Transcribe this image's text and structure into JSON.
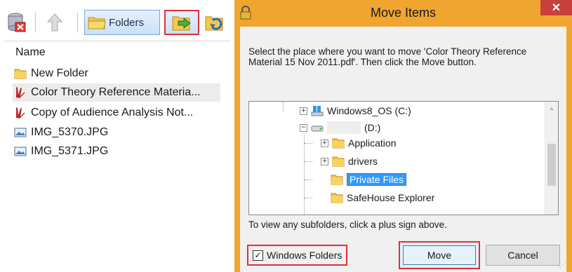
{
  "explorer": {
    "toolbar": {
      "folders_label": "Folders"
    },
    "column_header": "Name",
    "files": [
      {
        "name": "New Folder",
        "icon": "folder-icon"
      },
      {
        "name": "Color Theory Reference Materia...",
        "icon": "pdf-icon",
        "selected": true
      },
      {
        "name": "Copy of Audience Analysis  Not...",
        "icon": "pdf-icon"
      },
      {
        "name": "IMG_5370.JPG",
        "icon": "image-icon"
      },
      {
        "name": "IMG_5371.JPG",
        "icon": "image-icon"
      }
    ]
  },
  "dialog": {
    "title": "Move Items",
    "close_glyph": "✕",
    "instructions": "Select the place where you want to move 'Color Theory Reference Material 15 Nov 2011.pdf'. Then click the Move button.",
    "tree": [
      {
        "label": "Windows8_OS (C:)",
        "icon": "drive-icon"
      },
      {
        "label": "(D:)",
        "icon": "drive-icon"
      },
      {
        "label": "Application",
        "icon": "folder-icon"
      },
      {
        "label": "drivers",
        "icon": "folder-icon"
      },
      {
        "label": "Private Files",
        "icon": "folder-icon",
        "selected": true
      },
      {
        "label": "SafeHouse Explorer",
        "icon": "folder-icon"
      }
    ],
    "hint": "To view any subfolders, click a plus sign above.",
    "windows_folders_label": "Windows Folders",
    "windows_folders_checked": true,
    "move_label": "Move",
    "cancel_label": "Cancel"
  },
  "colors": {
    "dialog_frame": "#f0a531",
    "highlight_outline": "#e0303b",
    "selection": "#3399ff"
  }
}
